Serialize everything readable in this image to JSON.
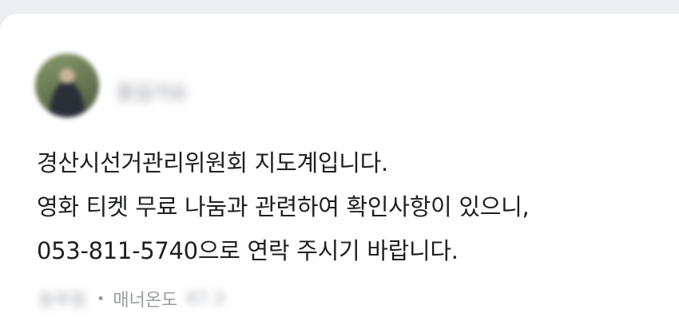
{
  "post": {
    "author": {
      "name": "홍길가요",
      "avatar_icon": "profile-photo"
    },
    "message_lines": [
      "경산시선거관리위원회 지도계입니다.",
      "영화 티켓 무료 나눔과 관련하여 확인사항이 있으니,",
      "053-811-5740으로 연락 주시기 바랍니다."
    ],
    "meta": {
      "location": "동부동",
      "separator": "•",
      "manner_label": "매너온도",
      "manner_value": "47.3"
    }
  },
  "colors": {
    "background": "#eceef1",
    "card": "#ffffff",
    "text": "#1e1f22",
    "muted": "#9a9da3"
  }
}
